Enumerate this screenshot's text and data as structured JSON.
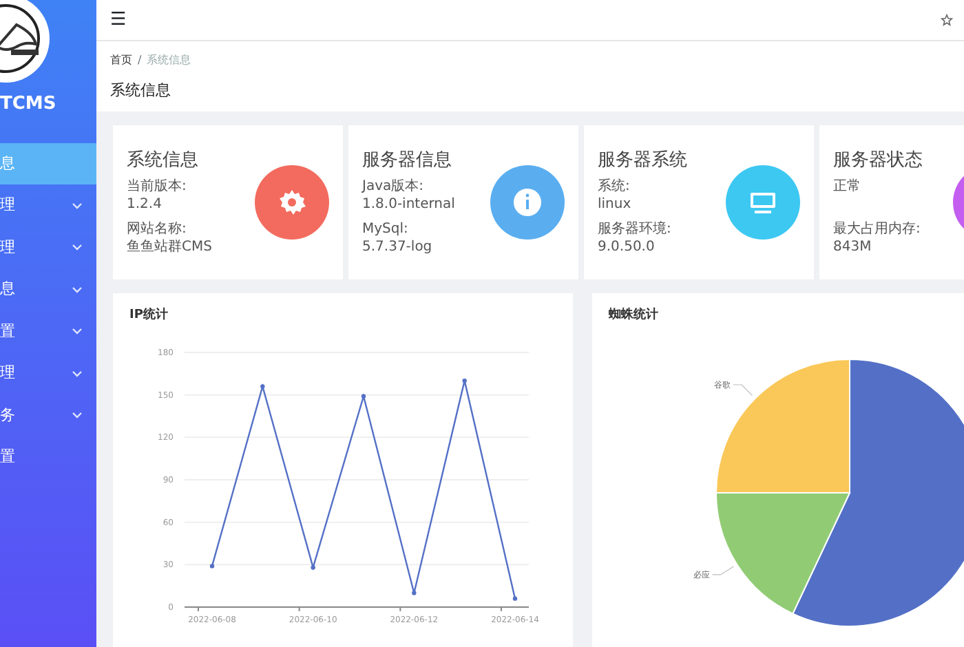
{
  "sidebar": {
    "brand": "TCMS",
    "items": [
      {
        "label": "息",
        "selected": true,
        "expandable": false
      },
      {
        "label": "理",
        "selected": false,
        "expandable": true
      },
      {
        "label": "理",
        "selected": false,
        "expandable": true
      },
      {
        "label": "息",
        "selected": false,
        "expandable": true
      },
      {
        "label": "置",
        "selected": false,
        "expandable": true
      },
      {
        "label": "理",
        "selected": false,
        "expandable": true
      },
      {
        "label": "务",
        "selected": false,
        "expandable": true
      },
      {
        "label": "置",
        "selected": false,
        "expandable": false
      }
    ]
  },
  "topbar": {
    "menu_icon": "☰"
  },
  "breadcrumb": {
    "separator": "/",
    "items": [
      {
        "label": "首页",
        "selected": false
      },
      {
        "label": "系统信息",
        "selected": true
      }
    ]
  },
  "page_title": "系统信息",
  "info_cards": [
    {
      "title": "系统信息",
      "groups": [
        [
          "当前版本:",
          "1.2.4"
        ],
        [
          "网站名称:",
          "鱼鱼站群CMS"
        ]
      ],
      "kind": "gear",
      "color": "#f26b5e"
    },
    {
      "title": "服务器信息",
      "groups": [
        [
          "Java版本:",
          "1.8.0-internal"
        ],
        [
          "MySql:",
          "5.7.37-log"
        ]
      ],
      "kind": "info",
      "color": "#5aaef0"
    },
    {
      "title": "服务器系统",
      "groups": [
        [
          "系统:",
          "linux"
        ],
        [
          "服务器环境:",
          "9.0.50.0"
        ]
      ],
      "kind": "monitor",
      "color": "#3dc8f2"
    },
    {
      "title": "服务器状态",
      "groups": [
        [
          "正常"
        ],
        [
          "最大占用内存:",
          "843M"
        ]
      ],
      "kind": "partial",
      "color": "#c45ef0"
    }
  ],
  "ip_chart": {
    "title": "IP统计",
    "chart_data": {
      "type": "line",
      "categories": [
        "2022-06-08",
        null,
        "2022-06-10",
        null,
        "2022-06-12",
        null,
        "2022-06-14"
      ],
      "ylim": [
        0,
        180
      ],
      "yticks": [
        0,
        30,
        60,
        90,
        120,
        150,
        180
      ],
      "grid": true,
      "series": [
        {
          "color": "#5470c6",
          "marker": "circle",
          "values": [
            29,
            156,
            28,
            149,
            10,
            160,
            6
          ]
        }
      ]
    }
  },
  "spider_chart": {
    "title": "蜘蛛统计",
    "slices": [
      {
        "color": "#5470c6"
      },
      {
        "label": "必应",
        "color": "#91cc75"
      },
      {
        "label": "谷歌",
        "color": "#fac858"
      }
    ]
  }
}
